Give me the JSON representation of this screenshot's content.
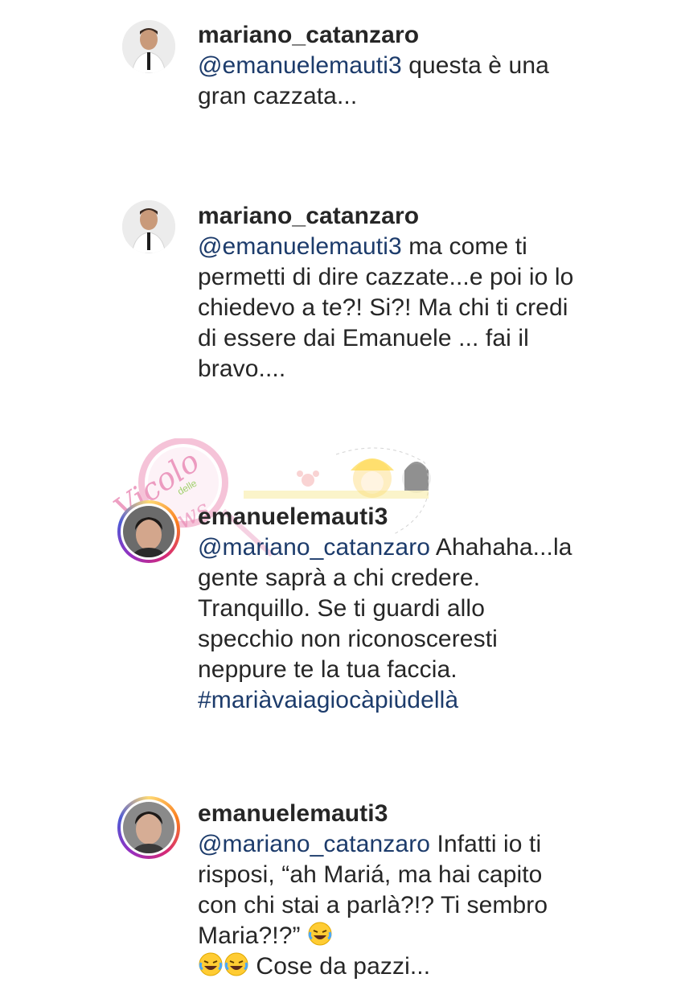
{
  "comments": [
    {
      "username": "mariano_catanzaro",
      "mention": "@emanuelemauti3",
      "text": " questa è una gran cazzata..."
    },
    {
      "username": "mariano_catanzaro",
      "mention": "@emanuelemauti3",
      "text": " ma come ti permetti di dire cazzate...e poi io lo chiedevo a te?! Si?! Ma chi ti credi di essere dai Emanuele ... fai il bravo...."
    },
    {
      "username": "emanuelemauti3",
      "mention": "@mariano_catanzaro",
      "text": " Ahahaha...la gente saprà a chi credere. Tranquillo. Se ti guardi allo specchio non riconosceresti neppure te la tua faccia. ",
      "hashtag": "#mariàvaiagiocàpiùdellà"
    },
    {
      "username": "emanuelemauti3",
      "mention": "@mariano_catanzaro",
      "text": " Infatti io ti risposi, “ah Mariá, ma hai capito con chi stai a parlà?!? Ti sembro Maria?!?” ",
      "text_after_emoji": " Cose da pazzi..."
    }
  ],
  "watermark": {
    "word": "Vicolo",
    "small": "delle",
    "bottom": "News"
  },
  "colors": {
    "mention": "#1c3b6b",
    "text": "#262626",
    "story_ring": "#d62976"
  }
}
